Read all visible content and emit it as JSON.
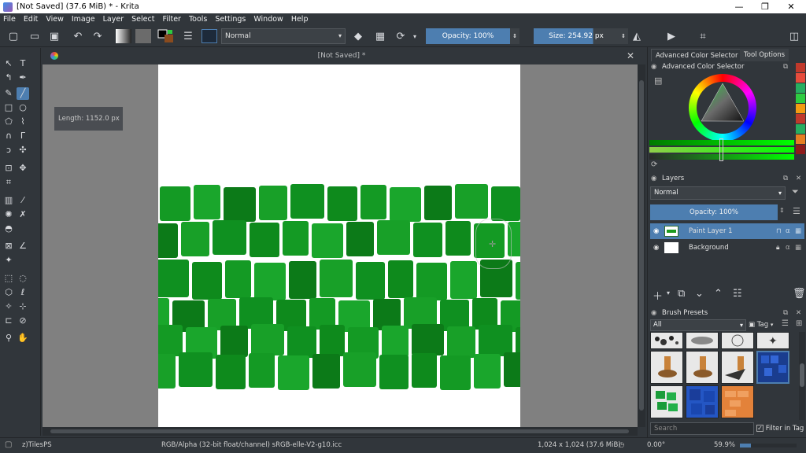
{
  "titlebar": {
    "title": "[Not Saved]  (37.6 MiB)  * - Krita",
    "minimize": "—",
    "maximize": "❐",
    "close": "✕"
  },
  "menu": [
    "File",
    "Edit",
    "View",
    "Image",
    "Layer",
    "Select",
    "Filter",
    "Tools",
    "Settings",
    "Window",
    "Help"
  ],
  "toolbar": {
    "blend_mode": "Normal",
    "opacity_label": "Opacity: 100%",
    "size_label": "Size: 254.92 px"
  },
  "document": {
    "tab_title": "[Not Saved]  *",
    "close": "✕",
    "measure_readout": "Length: 1152.0 px"
  },
  "right_panel": {
    "tabs": [
      "Advanced Color Selector",
      "Tool Options"
    ],
    "color_selector_title": "Advanced Color Selector",
    "palette_colors": [
      "#c0392b",
      "#e74c3c",
      "#27ae60",
      "#2ecc40",
      "#f39c12",
      "#c0392b",
      "#27ae60",
      "#e67e22",
      "#8e1b1b"
    ],
    "layers": {
      "title": "Layers",
      "blend_mode": "Normal",
      "opacity_label": "Opacity:  100%",
      "items": [
        {
          "name": "Paint Layer 1",
          "selected": true
        },
        {
          "name": "Background",
          "selected": false
        }
      ]
    },
    "brush_presets": {
      "title": "Brush Presets",
      "filter": "All",
      "tag_label": "Tag",
      "search_placeholder": "Search",
      "filter_in_tag": "Filter in Tag"
    }
  },
  "status": {
    "brush_name": "z)TilesPS",
    "color_space": "RGB/Alpha (32-bit float/channel)  sRGB-elle-V2-g10.icc",
    "image_size": "1,024 x 1,024 (37.6 MiB)",
    "rotation": "0.00°",
    "zoom": "59.9%"
  }
}
